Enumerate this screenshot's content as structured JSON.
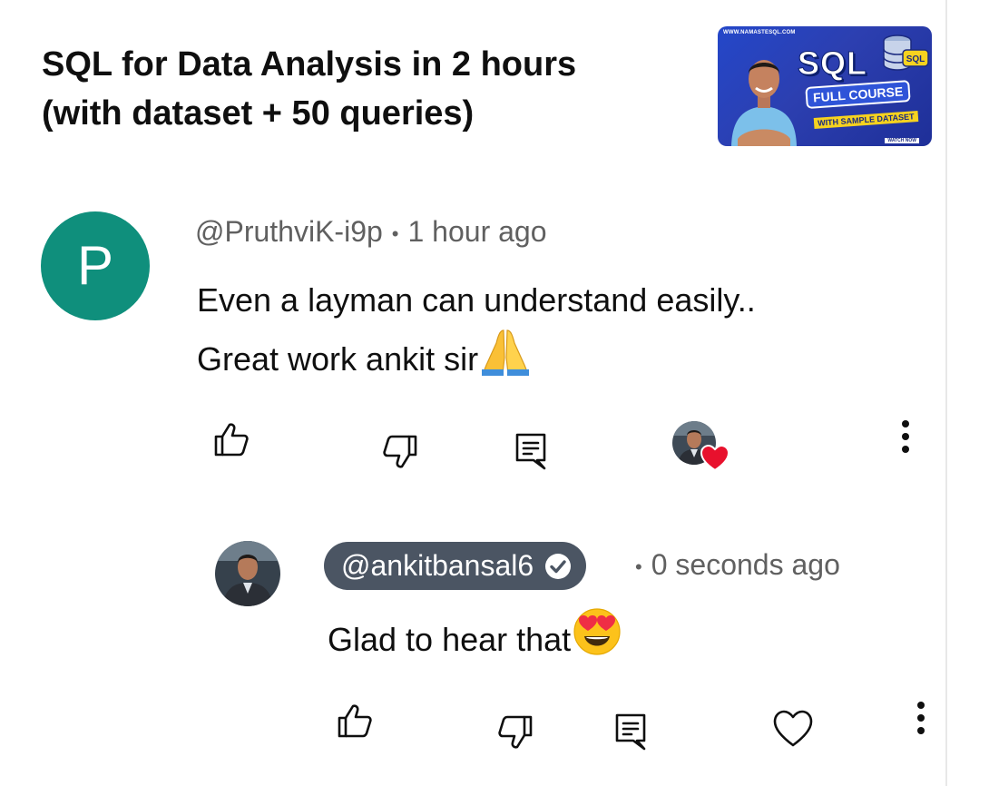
{
  "video": {
    "title_line1": "SQL for Data Analysis in 2 hours",
    "title_line2": "(with dataset + 50 queries)",
    "thumbnail": {
      "site": "WWW.NAMASTESQL.COM",
      "headline": "SQL",
      "badge": "FULL COURSE",
      "sub": "WITH SAMPLE DATASET",
      "cta": "WATCH NOW",
      "db_label": "SQL"
    }
  },
  "comment": {
    "avatar_letter": "P",
    "avatar_color": "#0f8f7c",
    "author": "@PruthviK-i9p",
    "separator": "•",
    "time": "1 hour ago",
    "text_line1": "Even a layman can understand easily..",
    "text_line2": "Great work ankit sir",
    "emoji": "folded-hands-emoji",
    "actions": [
      "like-icon",
      "dislike-icon",
      "reply-icon",
      "creator-heart-avatar",
      "more-options-icon"
    ]
  },
  "reply": {
    "author": "@ankitbansal6",
    "verified": true,
    "separator": "•",
    "time": "0 seconds ago",
    "text": "Glad to hear that",
    "emoji": "heart-eyes-emoji",
    "actions": [
      "like-icon",
      "dislike-icon",
      "reply-icon",
      "heart-icon",
      "more-options-icon"
    ]
  },
  "colors": {
    "heart_red": "#e8112d",
    "owner_pill": "#4b5563",
    "meta_gray": "#606060",
    "thumbnail_blue": "#2447c9",
    "highlight_yellow": "#f6d21f"
  }
}
